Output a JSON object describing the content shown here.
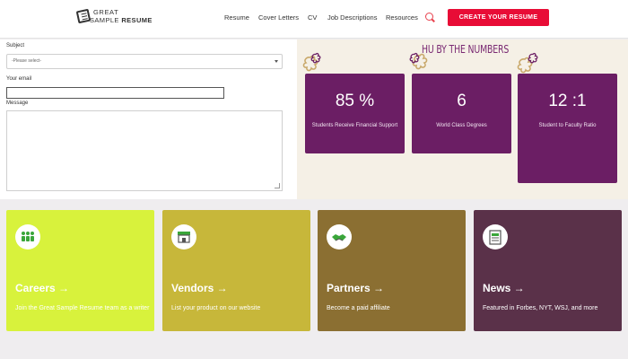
{
  "header": {
    "logo": {
      "line1": "GREAT",
      "line2_light": "SAMPLE",
      "line2_bold": "RESUME"
    },
    "nav": [
      "Resume",
      "Cover Letters",
      "CV",
      "Job Descriptions",
      "Resources"
    ],
    "cta_label": "CREATE YOUR RESUME"
  },
  "form": {
    "subject_label": "Subject",
    "subject_value": "-Please select-",
    "email_label": "Your email",
    "email_value": "",
    "message_label": "Message",
    "message_value": ""
  },
  "stats": {
    "title": "HU BY THE NUMBERS",
    "items": [
      {
        "value": "85 %",
        "label": "Students Receive Financial Support"
      },
      {
        "value": "6",
        "label": "World Class Degrees"
      },
      {
        "value": "12 :1",
        "label": "Student to Faculty Ratio"
      }
    ]
  },
  "tiles": [
    {
      "title": "Careers →",
      "desc": "Join the Great Sample Resume team as a writer",
      "bg": "#d8f23c",
      "icon": "people-icon"
    },
    {
      "title": "Vendors →",
      "desc": "List your product on our website",
      "bg": "#c7b73a",
      "icon": "storefront-icon"
    },
    {
      "title": "Partners →",
      "desc": "Become a paid affiliate",
      "bg": "#8b6f32",
      "icon": "handshake-icon"
    },
    {
      "title": "News →",
      "desc": "Featured in Forbes, NYT, WSJ, and more",
      "bg": "#5a3149",
      "icon": "newspaper-icon"
    }
  ],
  "colors": {
    "accent": "#e80c36",
    "stat_card": "#6b1e64",
    "stats_bg": "#f5f0e6",
    "page_bg": "#efedef"
  }
}
